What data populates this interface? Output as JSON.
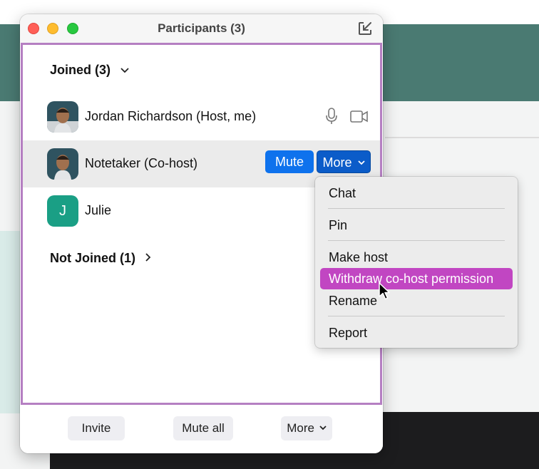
{
  "window": {
    "title": "Participants (3)"
  },
  "sections": {
    "joined": {
      "label": "Joined (3)"
    },
    "not_joined": {
      "label": "Not Joined (1)"
    }
  },
  "participants": [
    {
      "name": "Jordan Richardson (Host, me)",
      "avatar": "photo"
    },
    {
      "name": "Notetaker (Co-host)",
      "avatar": "photo"
    },
    {
      "name": "Julie",
      "avatar_letter": "J",
      "avatar_color": "#1a9f85"
    }
  ],
  "row_actions": {
    "mute_label": "Mute",
    "more_label": "More"
  },
  "menu": {
    "items": [
      "Chat",
      "Pin",
      "Make host",
      "Withdraw co-host permission",
      "Rename",
      "Report"
    ],
    "highlighted": "Withdraw co-host permission"
  },
  "footer": {
    "invite_label": "Invite",
    "mute_all_label": "Mute all",
    "more_label": "More"
  },
  "colors": {
    "accent_blue": "#0e72ed",
    "menu_highlight": "#c146c2",
    "content_border": "#b57fc2",
    "background_band": "#4a7a72"
  }
}
